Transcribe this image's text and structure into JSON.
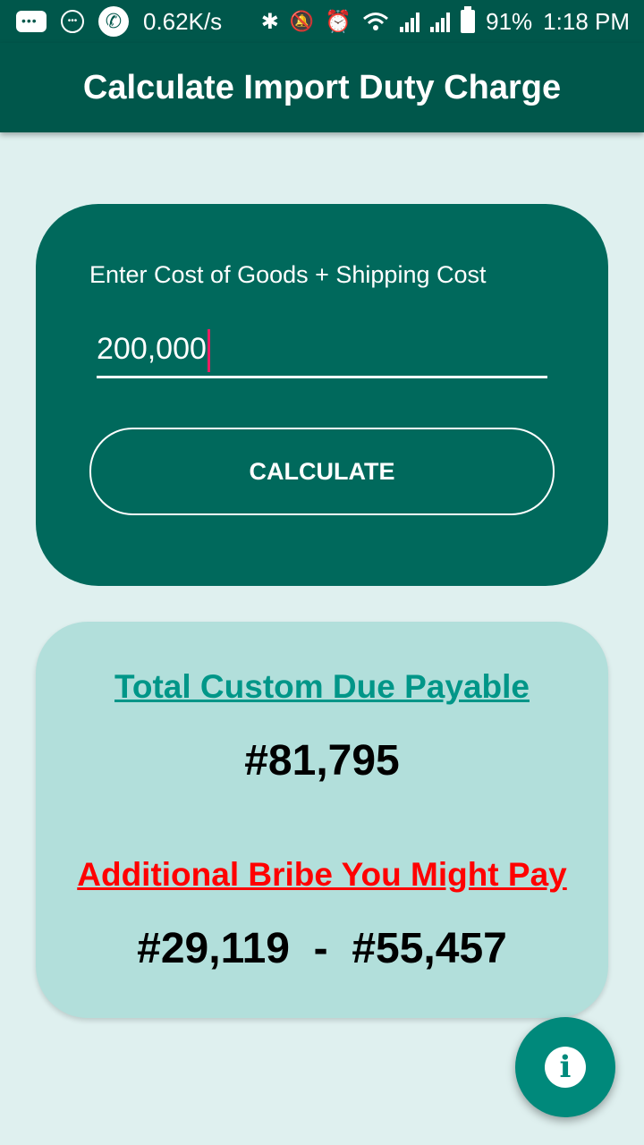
{
  "status_bar": {
    "speed": "0.62K/s",
    "battery": "91%",
    "time": "1:18 PM",
    "icons": [
      "message-icon",
      "dots-icon",
      "phone-icon",
      "bluetooth-icon",
      "mute-icon",
      "alarm-icon",
      "wifi-icon",
      "signal-icon",
      "signal-icon",
      "battery-icon"
    ]
  },
  "app_bar": {
    "title": "Calculate Import Duty Charge"
  },
  "input_card": {
    "label": "Enter Cost of Goods + Shipping Cost",
    "value": "200,000",
    "button_label": "CALCULATE"
  },
  "results": {
    "custom_heading": "Total Custom Due Payable",
    "custom_value": "#81,795",
    "bribe_heading": "Additional Bribe You Might Pay",
    "bribe_value": "#29,119  -  #55,457"
  },
  "fab": {
    "icon": "info-icon"
  },
  "colors": {
    "primary_dark": "#00574b",
    "card": "#00695c",
    "result_bg": "#b2dfdb",
    "custom_heading": "#009688",
    "bribe_heading": "#ff0000",
    "fab": "#00897b",
    "cursor": "#e91e63"
  }
}
